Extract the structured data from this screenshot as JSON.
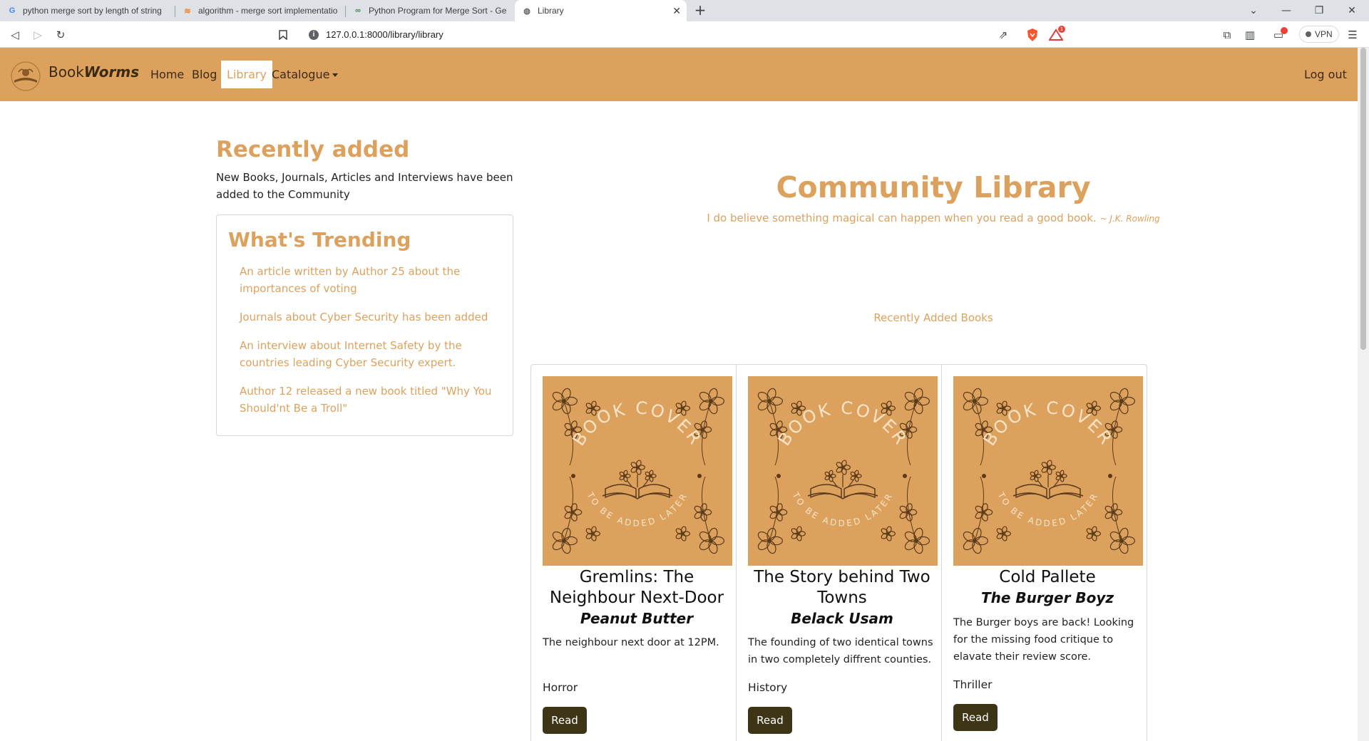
{
  "browser": {
    "tabs": [
      {
        "title": "python merge sort by length of string",
        "icon": "google-icon"
      },
      {
        "title": "algorithm - merge sort implementation",
        "icon": "stackoverflow-icon"
      },
      {
        "title": "Python Program for Merge Sort - Geeks",
        "icon": "geeksforgeeks-icon"
      },
      {
        "title": "Library",
        "icon": "globe-icon",
        "active": true
      }
    ],
    "url": "127.0.0.1:8000/library/library",
    "vpn_label": "VPN",
    "brave_badge_count": "1"
  },
  "navbar": {
    "brand_plain": "Book",
    "brand_bold": "Worms",
    "links": [
      "Home",
      "Blog",
      "Library",
      "Catalogue"
    ],
    "active_link": "Library",
    "logout": "Log out",
    "color": "#dda15e"
  },
  "recent": {
    "heading": "Recently added",
    "text": "New Books, Journals, Articles and Interviews have been added to the Community"
  },
  "trending": {
    "heading": "What's Trending",
    "items": [
      "An article written by Author 25 about the importances of voting",
      "Journals about Cyber Security has been added",
      "An interview about Internet Safety by the countries leading Cyber Security expert.",
      "Author 12 released a new book titled \"Why You Should'nt Be a Troll\""
    ]
  },
  "library": {
    "heading": "Community Library",
    "quote": "I do believe something magical can happen when you read a good book.",
    "quote_author": "~ J.K. Rowling",
    "recent_books_label": "Recently Added Books"
  },
  "cover": {
    "top_text": "BOOK COVER",
    "bottom_text": "TO BE ADDED LATER"
  },
  "books": [
    {
      "title": "Gremlins: The Neighbour Next-Door",
      "author": "Peanut Butter",
      "description": "The neighbour next door at 12PM.",
      "genre": "Horror",
      "button": "Read"
    },
    {
      "title": "The Story behind Two Towns",
      "author": "Belack Usam",
      "description": "The founding of two identical towns in two completely diffrent counties.",
      "genre": "History",
      "button": "Read"
    },
    {
      "title": "Cold Pallete",
      "author": "The Burger Boyz",
      "description": "The Burger boys are back! Looking for the missing food critique to elavate their review score.",
      "genre": "Thriller",
      "button": "Read"
    }
  ]
}
